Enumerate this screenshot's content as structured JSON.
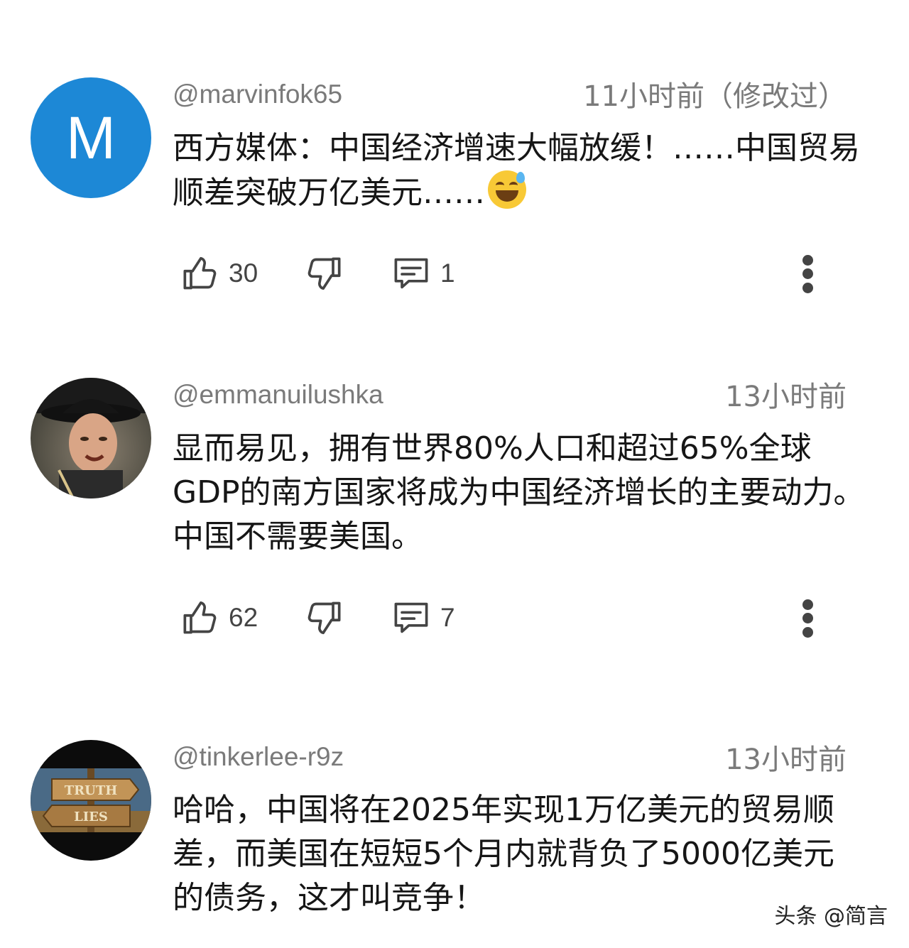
{
  "comments": [
    {
      "avatar_letter": "M",
      "handle": "@marvinfok65",
      "time": "11小时前（修改过）",
      "text": "西方媒体：中国经济增速大幅放缓！……中国贸易顺差突破万亿美元……",
      "emoji": "grinning-face-with-sweat",
      "likes": "30",
      "replies": "1"
    },
    {
      "avatar_letter": "",
      "handle": "@emmanuilushka",
      "time": "13小时前",
      "text": "显而易见，拥有世界80%人口和超过65%全球GDP的南方国家将成为中国经济增长的主要动力。中国不需要美国。",
      "likes": "62",
      "replies": "7"
    },
    {
      "avatar_letter": "",
      "handle": "@tinkerlee-r9z",
      "time": "13小时前",
      "text": "哈哈，中国将在2025年实现1万亿美元的贸易顺差，而美国在短短5个月内就背负了5000亿美元的债务，这才叫竞争！",
      "avatar_sign_top": "TRUTH",
      "avatar_sign_bottom": "LIES"
    }
  ],
  "watermark": "头条 @简言",
  "colors": {
    "avatar_blue": "#1d88d6",
    "meta_gray": "#7a7a7a",
    "text": "#161616"
  }
}
